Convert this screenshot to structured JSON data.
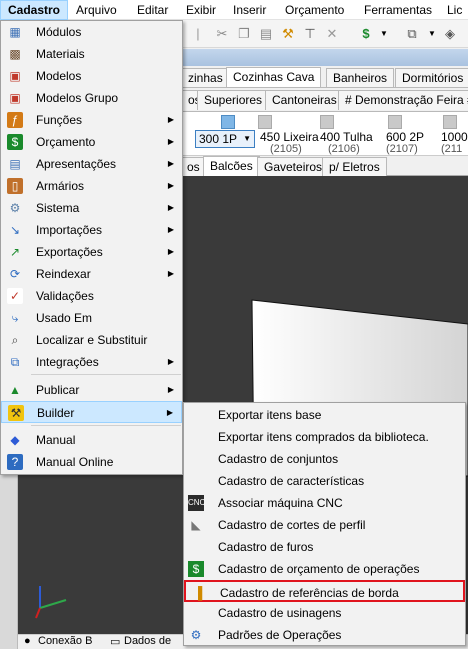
{
  "menubar": {
    "items": [
      "Cadastro",
      "Arquivo",
      "Editar",
      "Exibir",
      "Inserir",
      "Orçamento",
      "Ferramentas",
      "Lic"
    ]
  },
  "tabs_row1": [
    "zinhas",
    "Cozinhas Cava",
    "Banheiros",
    "Dormitórios"
  ],
  "tabs_row2": [
    "os",
    "Superiores",
    "Cantoneiras",
    "# Demonstração Feira #"
  ],
  "thumbnails": [
    {
      "line1": "",
      "line2": ""
    },
    {
      "line1": "450 Lixeira",
      "line2": "(2105)"
    },
    {
      "line1": "400 Tulha",
      "line2": "(2106)"
    },
    {
      "line1": "600 2P",
      "line2": "(2107)"
    },
    {
      "line1": "1000",
      "line2": "(211"
    }
  ],
  "combo_value": "300 1P",
  "subtabs": [
    "os",
    "Balcões",
    "Gaveteiros",
    "p/ Eletros"
  ],
  "status": {
    "item1": "Conexão B",
    "item2": "Dados de"
  },
  "main_menu": {
    "items": [
      {
        "label": "Módulos",
        "icon": "modules-icon",
        "submenu": false
      },
      {
        "label": "Materiais",
        "icon": "materials-icon",
        "submenu": false
      },
      {
        "label": "Modelos",
        "icon": "models-icon",
        "submenu": false
      },
      {
        "label": "Modelos Grupo",
        "icon": "models-group-icon",
        "submenu": false
      },
      {
        "label": "Funções",
        "icon": "functions-icon",
        "submenu": true
      },
      {
        "label": "Orçamento",
        "icon": "budget-icon",
        "submenu": true
      },
      {
        "label": "Apresentações",
        "icon": "presentations-icon",
        "submenu": true
      },
      {
        "label": "Armários",
        "icon": "cabinets-icon",
        "submenu": true
      },
      {
        "label": "Sistema",
        "icon": "system-gear-icon",
        "submenu": true
      },
      {
        "label": "Importações",
        "icon": "import-icon",
        "submenu": true
      },
      {
        "label": "Exportações",
        "icon": "export-icon",
        "submenu": true
      },
      {
        "label": "Reindexar",
        "icon": "reindex-icon",
        "submenu": true
      },
      {
        "label": "Validações",
        "icon": "validations-icon",
        "submenu": false
      },
      {
        "label": "Usado Em",
        "icon": "used-in-icon",
        "submenu": false
      },
      {
        "label": "Localizar e Substituir",
        "icon": "find-replace-icon",
        "submenu": false
      },
      {
        "label": "Integrações",
        "icon": "integrations-icon",
        "submenu": true
      },
      {
        "label": "Publicar",
        "icon": "publish-icon",
        "submenu": true
      },
      {
        "label": "Builder",
        "icon": "builder-icon",
        "submenu": true
      },
      {
        "label": "Manual",
        "icon": "manual-icon",
        "submenu": false
      },
      {
        "label": "Manual Online",
        "icon": "help-online-icon",
        "submenu": false
      }
    ]
  },
  "builder_submenu": {
    "items": [
      "Exportar itens base",
      "Exportar itens comprados da biblioteca.",
      "Cadastro de conjuntos",
      "Cadastro de características",
      "Associar máquina CNC",
      "Cadastro de cortes de perfil",
      "Cadastro de furos",
      "Cadastro de orçamento de operações",
      "Cadastro de referências de borda",
      "Cadastro de usinagens",
      "Padrões de Operações"
    ],
    "cnc_icon_text": "CNC"
  },
  "colors": {
    "highlight": "#cce8ff",
    "highlight_border": "#99d1ff",
    "annotation_box": "#e0141e",
    "viewport": "#3a3a3a"
  }
}
